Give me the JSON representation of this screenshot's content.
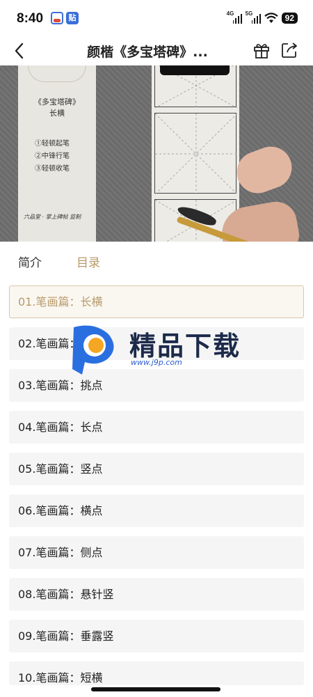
{
  "status_bar": {
    "time": "8:40",
    "app_badge": "贴",
    "network_label_1": "4G",
    "network_label_2": "5G",
    "battery": "92"
  },
  "nav": {
    "title": "颜楷《多宝塔碑》...",
    "back_icon": "chevron-left-icon",
    "gift_icon": "gift-icon",
    "share_icon": "share-icon"
  },
  "video": {
    "card_title": "《多宝塔碑》",
    "card_subtitle": "长横",
    "steps": [
      "①轻顿起笔",
      "②中锋行笔",
      "③轻顿收笔"
    ],
    "footer": "六品堂 · 掌上碑帖 监制"
  },
  "tabs": {
    "intro": "简介",
    "toc": "目录",
    "active": "toc"
  },
  "lessons": [
    "01.笔画篇：长横",
    "02.笔画篇：左",
    "03.笔画篇：挑点",
    "04.笔画篇：长点",
    "05.笔画篇：竖点",
    "06.笔画篇：横点",
    "07.笔画篇：侧点",
    "08.笔画篇：悬针竖",
    "09.笔画篇：垂露竖",
    "10.笔画篇：短横"
  ],
  "watermark": {
    "text": "精品下载",
    "url": "www.j9p.com"
  },
  "colors": {
    "accent": "#b89a6a",
    "item_bg": "#f5f5f5",
    "active_border": "#d8c8a8"
  }
}
